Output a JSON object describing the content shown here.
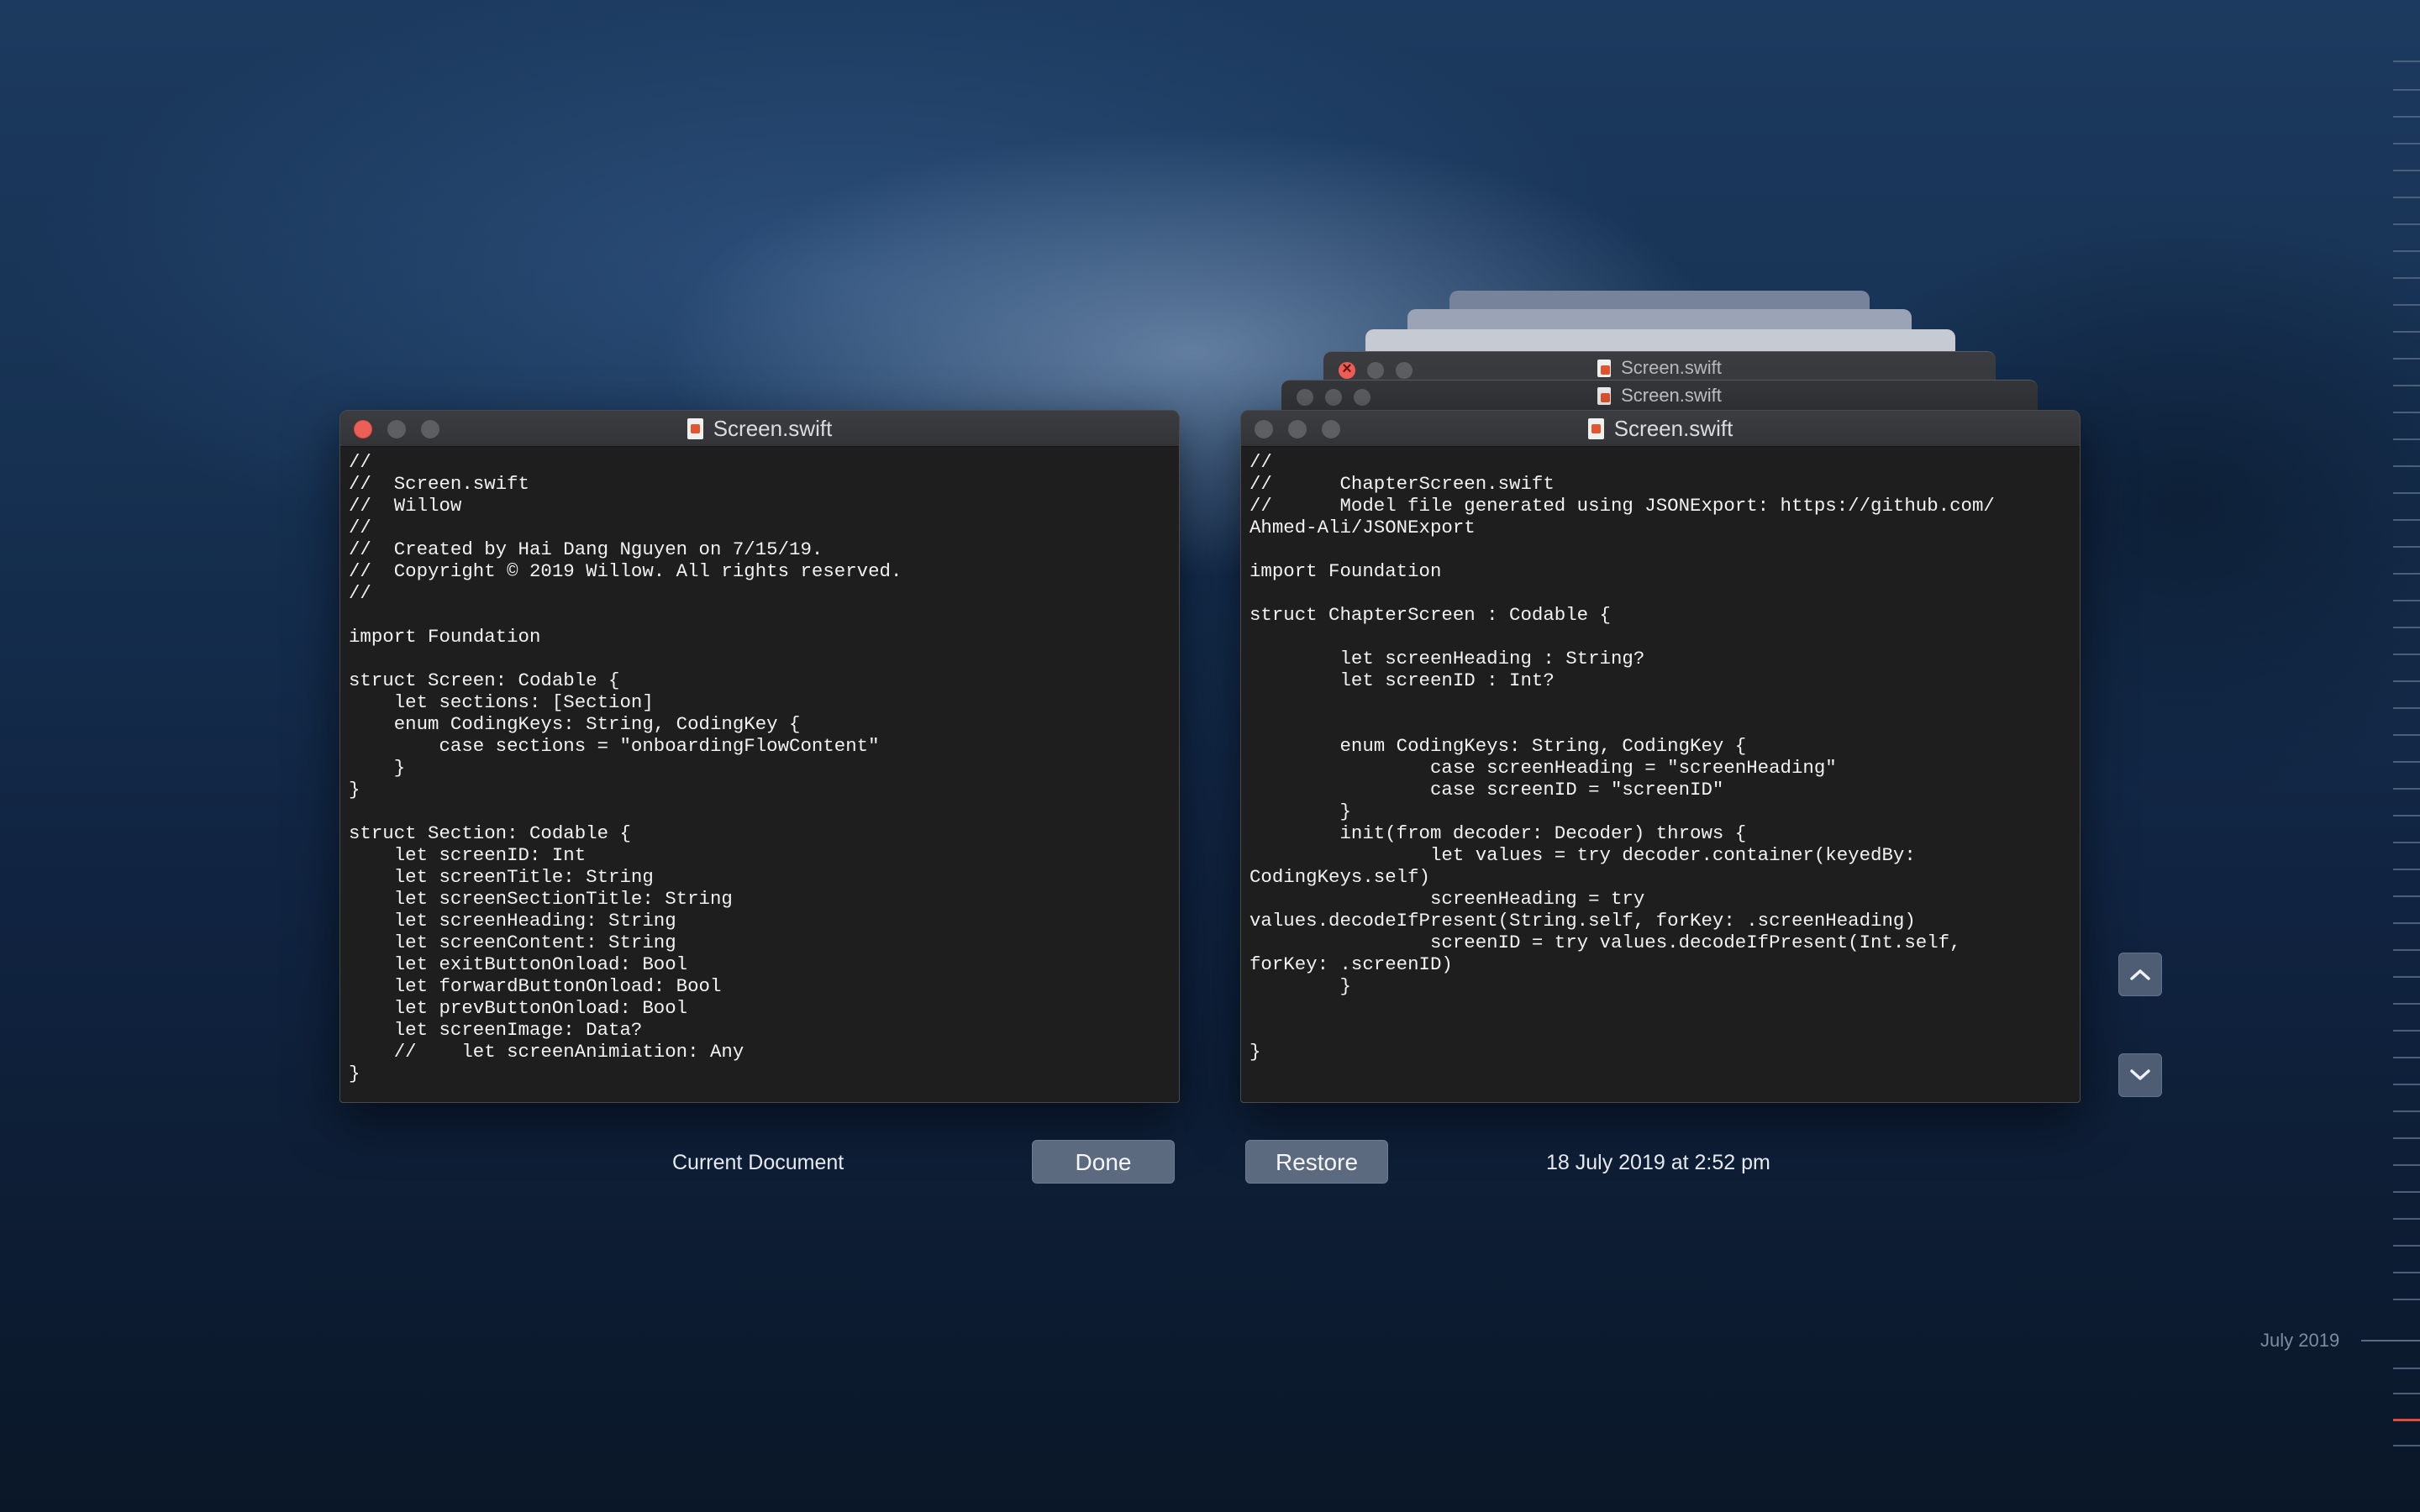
{
  "stack": {
    "windows": [
      {
        "title": "Screen.swift"
      },
      {
        "title": "Screen.swift"
      }
    ]
  },
  "left_window": {
    "title": "Screen.swift",
    "code": "//\n//  Screen.swift\n//  Willow\n//\n//  Created by Hai Dang Nguyen on 7/15/19.\n//  Copyright © 2019 Willow. All rights reserved.\n//\n\nimport Foundation\n\nstruct Screen: Codable {\n    let sections: [Section]\n    enum CodingKeys: String, CodingKey {\n        case sections = \"onboardingFlowContent\"\n    }\n}\n\nstruct Section: Codable {\n    let screenID: Int\n    let screenTitle: String\n    let screenSectionTitle: String\n    let screenHeading: String\n    let screenContent: String\n    let exitButtonOnload: Bool\n    let forwardButtonOnload: Bool\n    let prevButtonOnload: Bool\n    let screenImage: Data?\n    //    let screenAnimiation: Any\n}"
  },
  "right_window": {
    "title": "Screen.swift",
    "code": "//\n//      ChapterScreen.swift\n//      Model file generated using JSONExport: https://github.com/\nAhmed-Ali/JSONExport\n\nimport Foundation\n\nstruct ChapterScreen : Codable {\n\n        let screenHeading : String?\n        let screenID : Int?\n\n\n        enum CodingKeys: String, CodingKey {\n                case screenHeading = \"screenHeading\"\n                case screenID = \"screenID\"\n        }\n        init(from decoder: Decoder) throws {\n                let values = try decoder.container(keyedBy:\nCodingKeys.self)\n                screenHeading = try\nvalues.decodeIfPresent(String.self, forKey: .screenHeading)\n                screenID = try values.decodeIfPresent(Int.self,\nforKey: .screenID)\n        }\n\n\n}"
  },
  "footer": {
    "current_label": "Current Document",
    "done_label": "Done",
    "restore_label": "Restore",
    "version_date": "18 July 2019 at 2:52 pm"
  },
  "timeline": {
    "month_label": "July 2019"
  },
  "colors": {
    "close_red": "#ec5f57",
    "button_bg": "#5c6a80",
    "timeline_current": "#e5483e"
  }
}
